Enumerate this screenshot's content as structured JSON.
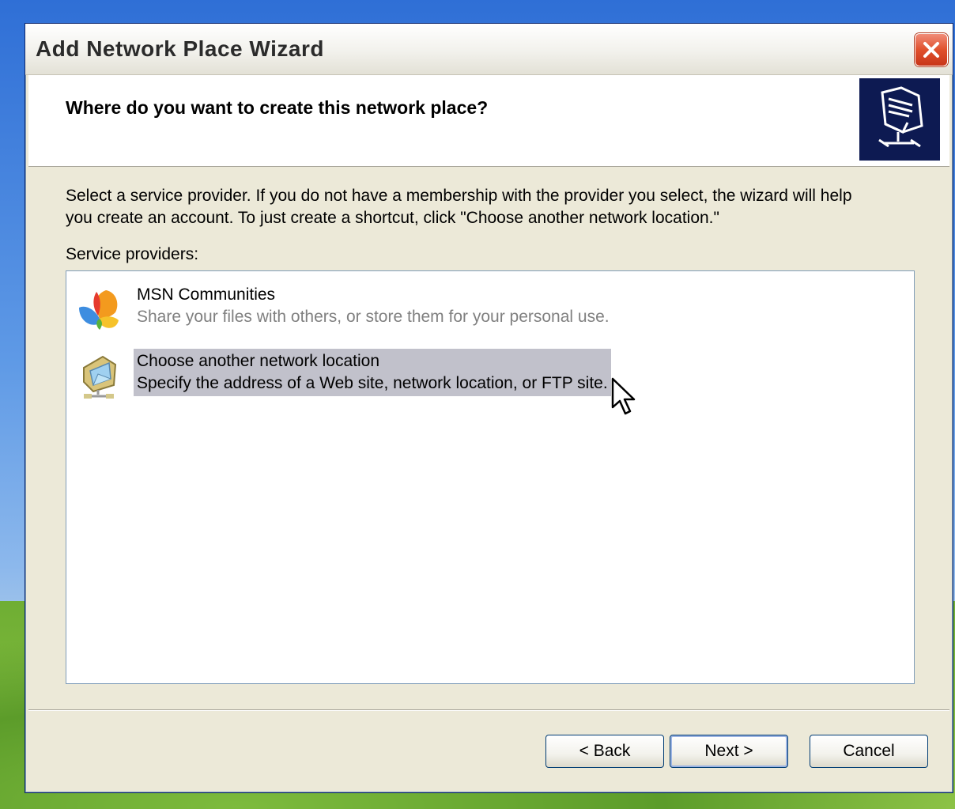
{
  "window": {
    "title": "Add Network Place Wizard"
  },
  "header": {
    "title": "Where do you want to create this network place?",
    "icon": "network-folder-icon"
  },
  "body": {
    "description_line1": "Select a service provider.  If you do not have a membership with the provider you select, the wizard will help",
    "description_line2": "you create an account.  To just create a shortcut, click \"Choose another network location.\"",
    "list_label": "Service providers:"
  },
  "providers": [
    {
      "name": "MSN Communities",
      "description": "Share your files with others, or store them for your personal use.",
      "icon": "msn-butterfly-icon",
      "selected": false
    },
    {
      "name": "Choose another network location",
      "description": "Specify the address of a Web site, network location, or FTP site.",
      "icon": "network-location-icon",
      "selected": true
    }
  ],
  "buttons": {
    "back": "< Back",
    "next": "Next >",
    "cancel": "Cancel"
  },
  "colors": {
    "selection": "#c1c1cb",
    "window_bg": "#ece9d8",
    "header_icon_bg": "#0d1a52"
  }
}
